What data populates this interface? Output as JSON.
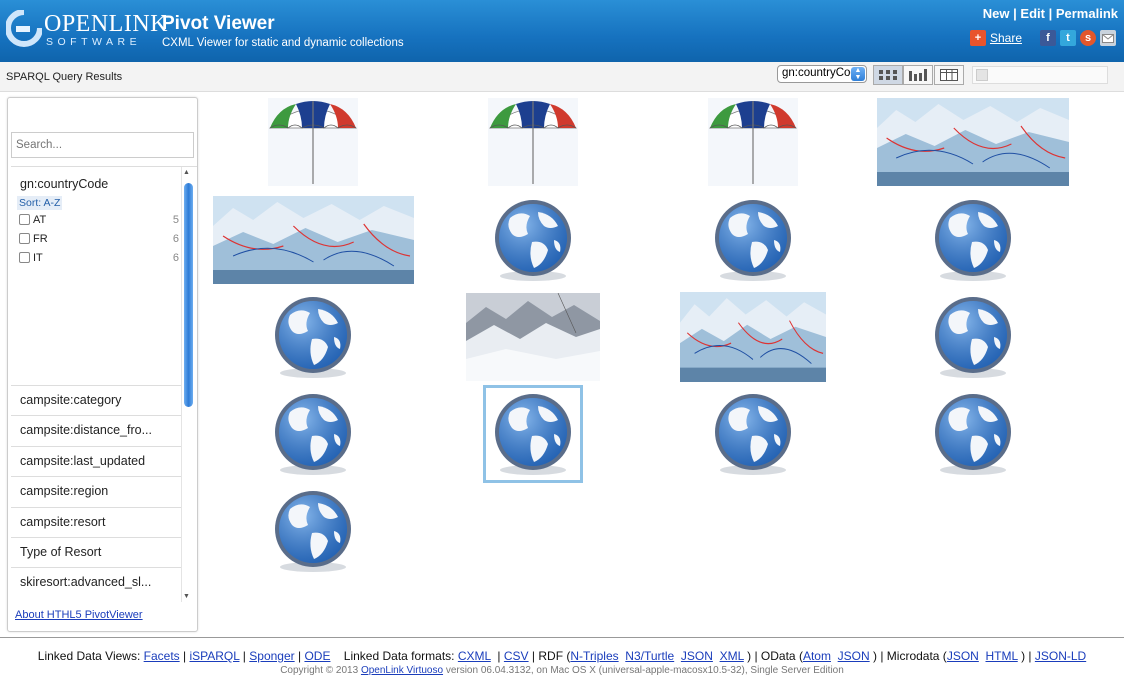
{
  "header": {
    "logo_name": "OPENLINK",
    "logo_sub": "SOFTWARE",
    "title": "Pivot Viewer",
    "subtitle": "CXML Viewer for static and dynamic collections",
    "links": [
      "New",
      "Edit",
      "Permalink"
    ],
    "share_label": "Share"
  },
  "toolbar": {
    "results_label": "SPARQL Query Results",
    "sort_value": "gn:countryCode",
    "views": [
      "grid-view-icon",
      "bar-chart-view-icon",
      "table-view-icon"
    ]
  },
  "sidebar": {
    "search_placeholder": "Search...",
    "open_facet": {
      "title": "gn:countryCode",
      "sort_label": "Sort: A-Z",
      "options": [
        {
          "label": "AT",
          "count": "5"
        },
        {
          "label": "FR",
          "count": "6"
        },
        {
          "label": "IT",
          "count": "6"
        }
      ]
    },
    "facets": [
      "campsite:category",
      "campsite:distance_fro...",
      "campsite:last_updated",
      "campsite:region",
      "campsite:resort",
      "Type of Resort",
      "skiresort:advanced_sl..."
    ],
    "about_link": "About HTHL5 PivotViewer"
  },
  "grid": {
    "tiles": [
      {
        "kind": "umbrella"
      },
      {
        "kind": "umbrella"
      },
      {
        "kind": "umbrella"
      },
      {
        "kind": "ski-map"
      },
      {
        "kind": "ski-map"
      },
      {
        "kind": "globe"
      },
      {
        "kind": "globe"
      },
      {
        "kind": "globe"
      },
      {
        "kind": "globe"
      },
      {
        "kind": "photo"
      },
      {
        "kind": "ski-map"
      },
      {
        "kind": "globe"
      },
      {
        "kind": "globe"
      },
      {
        "kind": "globe",
        "selected": true
      },
      {
        "kind": "globe"
      },
      {
        "kind": "globe"
      },
      {
        "kind": "globe"
      }
    ]
  },
  "footer": {
    "linked_views_label": "Linked Data Views:",
    "views": [
      "Facets",
      "iSPARQL",
      "Sponger",
      "ODE"
    ],
    "formats_label": "Linked Data formats:",
    "formats": [
      "CXML",
      "CSV"
    ],
    "rdf_label": "RDF",
    "rdf": [
      "N-Triples",
      "N3/Turtle",
      "JSON",
      "XML"
    ],
    "odata_label": "OData",
    "odata": [
      "Atom",
      "JSON"
    ],
    "microdata_label": "Microdata",
    "microdata": [
      "JSON",
      "HTML"
    ],
    "jsonld": "JSON-LD",
    "copyright_pre": "Copyright © 2013",
    "copyright_link": "OpenLink Virtuoso",
    "copyright_post": "version 06.04.3132, on Mac OS X (universal-apple-macosx10.5-32), Single Server Edition"
  }
}
